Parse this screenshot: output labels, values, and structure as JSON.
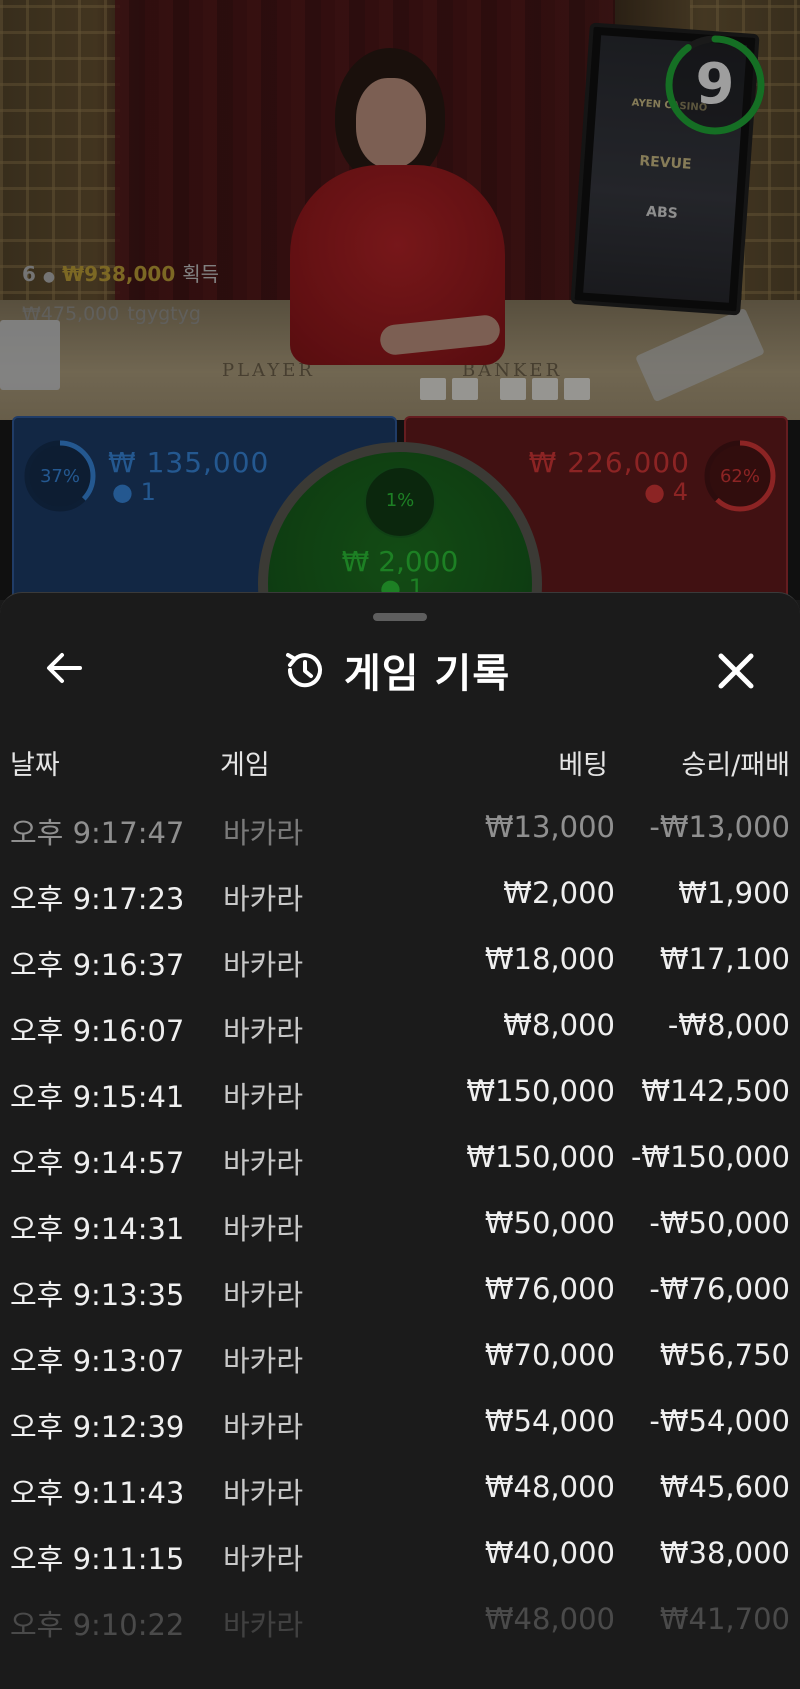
{
  "live": {
    "countdown": "9",
    "winners": {
      "count": "6",
      "amount": "₩938,000",
      "suffix": "획득"
    },
    "last_winner": {
      "amount": "₩475,000",
      "name": "tgygtyg"
    },
    "table_labels": {
      "player": "PLAYER",
      "banker": "BANKER"
    },
    "sponsors": [
      "AYEN CASINO",
      "REVUE",
      "ABS"
    ]
  },
  "bets": {
    "player": {
      "percent": "37%",
      "amount": "₩ 135,000",
      "players": "1"
    },
    "tie": {
      "percent": "1%",
      "amount": "₩ 2,000",
      "players": "1"
    },
    "banker": {
      "percent": "62%",
      "amount": "₩ 226,000",
      "players": "4"
    }
  },
  "history": {
    "title": "게임 기록",
    "columns": {
      "date": "날짜",
      "game": "게임",
      "bet": "베팅",
      "result": "승리/패배"
    },
    "rows": [
      {
        "time": "오후 9:17:47",
        "game": "바카라",
        "bet": "₩13,000",
        "result": "-₩13,000"
      },
      {
        "time": "오후 9:17:23",
        "game": "바카라",
        "bet": "₩2,000",
        "result": "₩1,900"
      },
      {
        "time": "오후 9:16:37",
        "game": "바카라",
        "bet": "₩18,000",
        "result": "₩17,100"
      },
      {
        "time": "오후 9:16:07",
        "game": "바카라",
        "bet": "₩8,000",
        "result": "-₩8,000"
      },
      {
        "time": "오후 9:15:41",
        "game": "바카라",
        "bet": "₩150,000",
        "result": "₩142,500"
      },
      {
        "time": "오후 9:14:57",
        "game": "바카라",
        "bet": "₩150,000",
        "result": "-₩150,000"
      },
      {
        "time": "오후 9:14:31",
        "game": "바카라",
        "bet": "₩50,000",
        "result": "-₩50,000"
      },
      {
        "time": "오후 9:13:35",
        "game": "바카라",
        "bet": "₩76,000",
        "result": "-₩76,000"
      },
      {
        "time": "오후 9:13:07",
        "game": "바카라",
        "bet": "₩70,000",
        "result": "₩56,750"
      },
      {
        "time": "오후 9:12:39",
        "game": "바카라",
        "bet": "₩54,000",
        "result": "-₩54,000"
      },
      {
        "time": "오후 9:11:43",
        "game": "바카라",
        "bet": "₩48,000",
        "result": "₩45,600"
      },
      {
        "time": "오후 9:11:15",
        "game": "바카라",
        "bet": "₩40,000",
        "result": "₩38,000"
      },
      {
        "time": "오후 9:10:22",
        "game": "바카라",
        "bet": "₩48,000",
        "result": "₩41,700"
      }
    ]
  },
  "colors": {
    "player": "#3b8fe8",
    "banker": "#e23a3a",
    "tie": "#2fcf3a",
    "timer": "#22b43a",
    "gold": "#c8a93a"
  },
  "icons": {
    "back": "arrow-left-icon",
    "history": "history-icon",
    "close": "close-icon"
  }
}
